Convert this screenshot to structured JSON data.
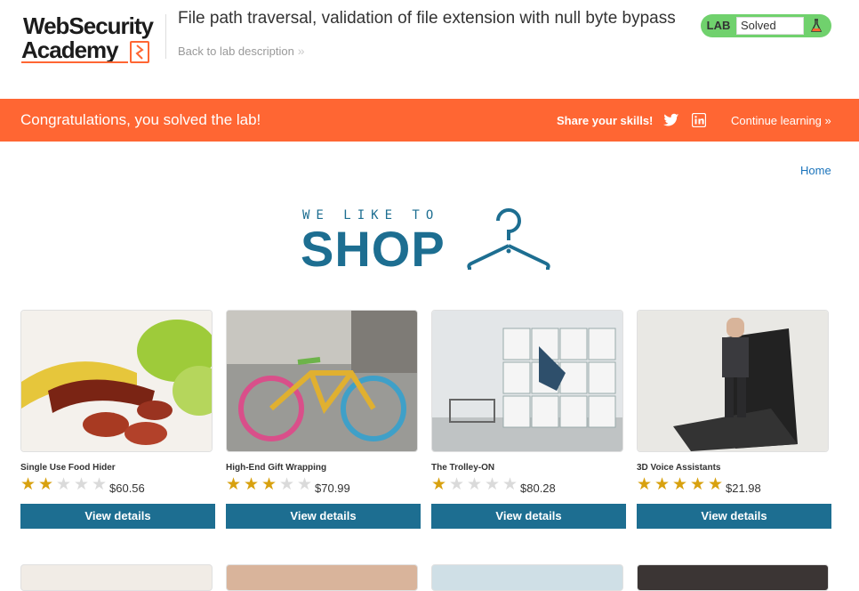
{
  "header": {
    "logo_line1": "WebSecurity",
    "logo_line2": "Academy",
    "lab_title": "File path traversal, validation of file extension with null byte bypass",
    "back_link": "Back to lab description",
    "status_tag": "LAB",
    "status_value": "Solved"
  },
  "banner": {
    "message": "Congratulations, you solved the lab!",
    "share_label": "Share your skills!",
    "continue_label": "Continue learning"
  },
  "nav": {
    "home": "Home"
  },
  "shop_logo": {
    "tagline": "WE LIKE TO",
    "word": "SHOP"
  },
  "products": [
    {
      "name": "Single Use Food Hider",
      "rating": 2,
      "price": "$60.56",
      "button": "View details"
    },
    {
      "name": "High-End Gift Wrapping",
      "rating": 3,
      "price": "$70.99",
      "button": "View details"
    },
    {
      "name": "The Trolley-ON",
      "rating": 1,
      "price": "$80.28",
      "button": "View details"
    },
    {
      "name": "3D Voice Assistants",
      "rating": 5,
      "price": "$21.98",
      "button": "View details"
    }
  ],
  "colors": {
    "accent": "#ff6633",
    "primary": "#1d6e91",
    "solved": "#70d16d",
    "star": "#d8a10f"
  },
  "icons": [
    "flask-icon",
    "twitter-icon",
    "linkedin-icon",
    "hanger-icon",
    "star-icon"
  ]
}
